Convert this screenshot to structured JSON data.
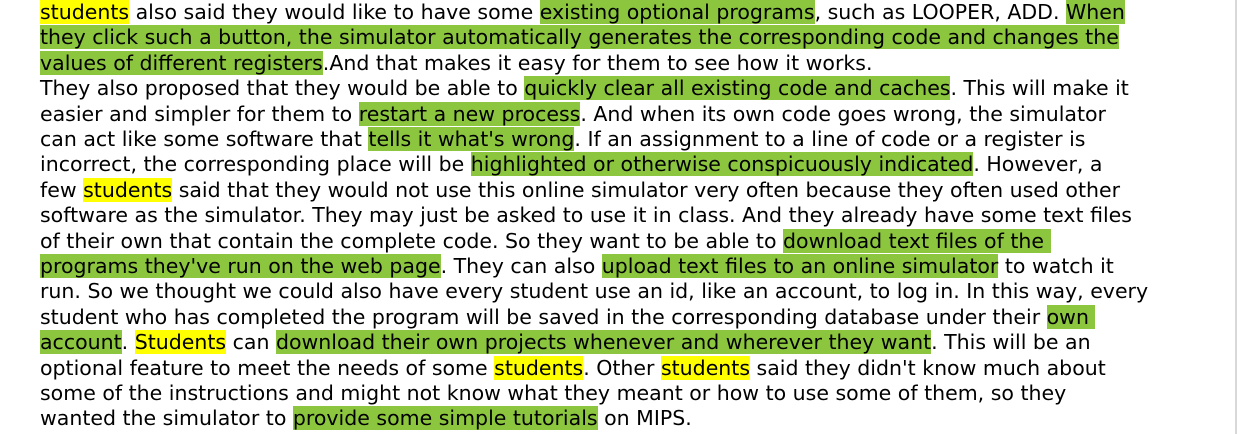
{
  "colors": {
    "keyword_highlight": "#ffff00",
    "requirement_highlight": "#8cc63f",
    "text": "#000000",
    "background": "#ffffff"
  },
  "lines": [
    [
      {
        "t": "students",
        "h": "kw"
      },
      {
        "t": " also said they would like to have some ",
        "h": ""
      },
      {
        "t": "existing optional programs",
        "h": "req"
      },
      {
        "t": ", such as LOOPER, ADD. ",
        "h": ""
      },
      {
        "t": "When",
        "h": "req"
      }
    ],
    [
      {
        "t": "they click such a button, the simulator automatically generates the corresponding code and changes the",
        "h": "req"
      }
    ],
    [
      {
        "t": "values of different registers",
        "h": "req"
      },
      {
        "t": ".And that makes it easy for them to see how it works.",
        "h": ""
      }
    ],
    [
      {
        "t": "They also proposed that they would be able to ",
        "h": ""
      },
      {
        "t": "quickly clear all existing code and caches",
        "h": "req"
      },
      {
        "t": ". This will make it",
        "h": ""
      }
    ],
    [
      {
        "t": "easier and simpler for them to ",
        "h": ""
      },
      {
        "t": "restart a new process",
        "h": "req"
      },
      {
        "t": ". And when its own code goes wrong, the simulator",
        "h": ""
      }
    ],
    [
      {
        "t": "can act like some software that ",
        "h": ""
      },
      {
        "t": "tells it what's wrong",
        "h": "req"
      },
      {
        "t": ". If an assignment to a line of code or a register is",
        "h": ""
      }
    ],
    [
      {
        "t": "incorrect, the corresponding place will be ",
        "h": ""
      },
      {
        "t": "highlighted or otherwise conspicuously indicated",
        "h": "req"
      },
      {
        "t": ". However, a",
        "h": ""
      }
    ],
    [
      {
        "t": "few ",
        "h": ""
      },
      {
        "t": "students",
        "h": "kw"
      },
      {
        "t": " said that they would not use this online simulator very often because they often used other",
        "h": ""
      }
    ],
    [
      {
        "t": "software as the simulator. They may just be asked to use it in class. And they already have some text files",
        "h": ""
      }
    ],
    [
      {
        "t": "of their own that contain the complete code. So they want to be able to ",
        "h": ""
      },
      {
        "t": "download text files of the ",
        "h": "req"
      }
    ],
    [
      {
        "t": "programs they've run on the web page",
        "h": "req"
      },
      {
        "t": ". They can also ",
        "h": ""
      },
      {
        "t": "upload text files to an online simulator",
        "h": "req"
      },
      {
        "t": " to watch it",
        "h": ""
      }
    ],
    [
      {
        "t": "run. So we thought we could also have every student use an id, like an account, to log in. In this way, every",
        "h": ""
      }
    ],
    [
      {
        "t": "student who has completed the program will be saved in the corresponding database under their ",
        "h": ""
      },
      {
        "t": "own ",
        "h": "req"
      }
    ],
    [
      {
        "t": "account",
        "h": "req"
      },
      {
        "t": ". ",
        "h": ""
      },
      {
        "t": "Students",
        "h": "kw"
      },
      {
        "t": " can ",
        "h": ""
      },
      {
        "t": "download their own projects whenever and wherever they want",
        "h": "req"
      },
      {
        "t": ". This will be an",
        "h": ""
      }
    ],
    [
      {
        "t": "optional feature to meet the needs of some ",
        "h": ""
      },
      {
        "t": "students",
        "h": "kw"
      },
      {
        "t": ". Other ",
        "h": ""
      },
      {
        "t": "students",
        "h": "kw"
      },
      {
        "t": " said they didn't know much about",
        "h": ""
      }
    ],
    [
      {
        "t": "some of the instructions and might not know what they meant or how to use some of them, so they",
        "h": ""
      }
    ],
    [
      {
        "t": "wanted the simulator to ",
        "h": ""
      },
      {
        "t": "provide some simple tutorials",
        "h": "req"
      },
      {
        "t": " on MIPS.",
        "h": ""
      }
    ]
  ]
}
